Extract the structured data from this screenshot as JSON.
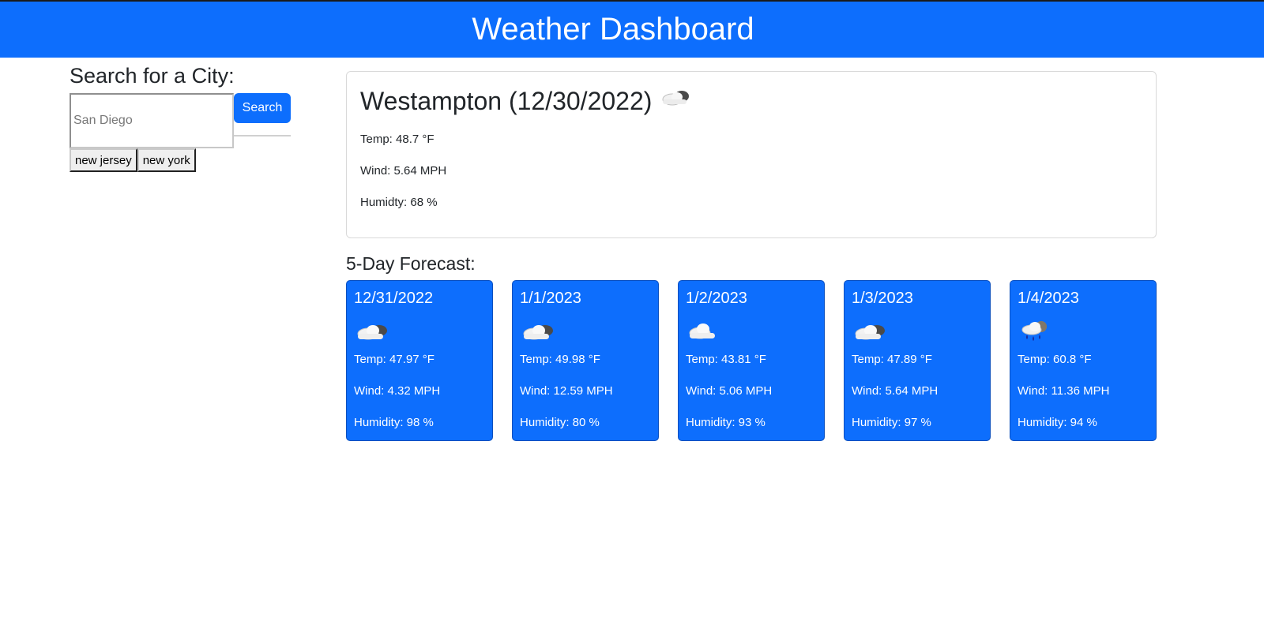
{
  "header": {
    "title": "Weather Dashboard"
  },
  "search": {
    "heading": "Search for a City:",
    "placeholder": "San Diego",
    "button_label": "Search",
    "history": [
      "new jersey",
      "new york"
    ]
  },
  "current": {
    "title": "Westampton (12/30/2022)",
    "icon": "cloud-sun-icon",
    "temp": "Temp: 48.7 °F",
    "wind": "Wind: 5.64 MPH",
    "humidity": "Humidty: 68 %"
  },
  "forecast": {
    "title": "5-Day Forecast:",
    "days": [
      {
        "date": "12/31/2022",
        "icon": "broken-clouds-icon",
        "temp": "Temp: 47.97 °F",
        "wind": "Wind: 4.32 MPH",
        "humidity": "Humidity: 98 %"
      },
      {
        "date": "1/1/2023",
        "icon": "broken-clouds-icon",
        "temp": "Temp: 49.98 °F",
        "wind": "Wind: 12.59 MPH",
        "humidity": "Humidity: 80 %"
      },
      {
        "date": "1/2/2023",
        "icon": "cloud-icon",
        "temp": "Temp: 43.81 °F",
        "wind": "Wind: 5.06 MPH",
        "humidity": "Humidity: 93 %"
      },
      {
        "date": "1/3/2023",
        "icon": "broken-clouds-icon",
        "temp": "Temp: 47.89 °F",
        "wind": "Wind: 5.64 MPH",
        "humidity": "Humidity: 97 %"
      },
      {
        "date": "1/4/2023",
        "icon": "rain-icon",
        "temp": "Temp: 60.8 °F",
        "wind": "Wind: 11.36 MPH",
        "humidity": "Humidity: 94 %"
      }
    ]
  },
  "colors": {
    "primary": "#0d6efd",
    "text": "#212529"
  }
}
